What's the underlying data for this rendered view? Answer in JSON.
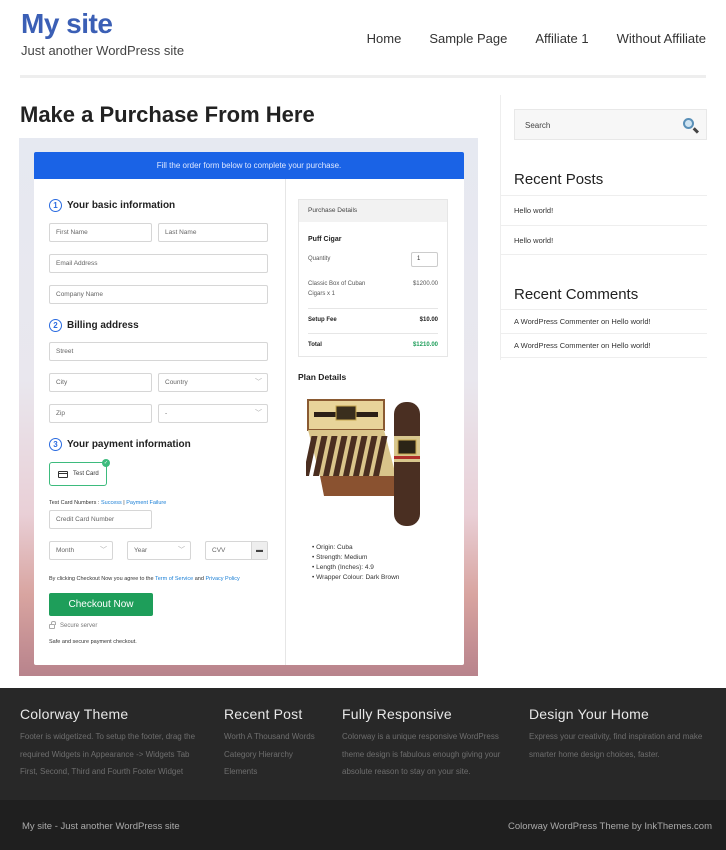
{
  "site": {
    "title": "My site",
    "tagline": "Just another WordPress site"
  },
  "nav": [
    "Home",
    "Sample Page",
    "Affiliate 1",
    "Without Affiliate"
  ],
  "page_title": "Make a Purchase From Here",
  "form": {
    "banner": "Fill the order form below to complete your purchase.",
    "section1": {
      "num": "1",
      "title": "Your basic information"
    },
    "section2": {
      "num": "2",
      "title": "Billing address"
    },
    "section3": {
      "num": "3",
      "title": "Your payment information"
    },
    "placeholders": {
      "first_name": "First Name",
      "last_name": "Last Name",
      "email": "Email Address",
      "company": "Company Name",
      "street": "Street",
      "city": "City",
      "country": "Country",
      "zip": "Zip",
      "state": "-",
      "card_number": "Credit Card Number",
      "month": "Month",
      "year": "Year",
      "cvv": "CVV"
    },
    "payment_method": "Test Card",
    "test_card_label": "Test Card Numbers :",
    "test_success": "Success",
    "test_sep": "|",
    "test_failure": "Payment Failure",
    "agree_prefix": "By clicking Checkout Now you agree to the",
    "terms": "Term of Service",
    "agree_and": "and",
    "privacy": "Privacy Policy",
    "checkout_label": "Checkout Now",
    "secure_label": "Secure server",
    "safe_label": "Safe and secure payment checkout."
  },
  "purchase": {
    "header": "Purchase Details",
    "product": "Puff Cigar",
    "quantity_label": "Quantity",
    "quantity": "1",
    "item_line1": "Classic Box of Cuban",
    "item_line2": "Cigars x 1",
    "item_price": "$1200.00",
    "setup_label": "Setup Fee",
    "setup_price": "$10.00",
    "total_label": "Total",
    "total_price": "$1210.00",
    "total_color": "#1e9e5a"
  },
  "plan": {
    "title": "Plan Details",
    "bullets": [
      "Origin: Cuba",
      "Strength: Medium",
      "Length (Inches): 4.9",
      "Wrapper Colour: Dark Brown"
    ]
  },
  "sidebar": {
    "search_placeholder": "Search",
    "recent_posts_title": "Recent Posts",
    "recent_posts": [
      "Hello world!",
      "Hello world!"
    ],
    "recent_comments_title": "Recent Comments",
    "recent_comments": [
      "A WordPress Commenter on Hello world!",
      "A WordPress Commenter on Hello world!"
    ]
  },
  "footer": {
    "cols": [
      {
        "title": "Colorway Theme",
        "lines": [
          "Footer is widgetized. To setup the footer, drag the",
          "required Widgets in Appearance -> Widgets Tab",
          "First, Second, Third and Fourth Footer Widget"
        ]
      },
      {
        "title": "Recent Post",
        "lines": [
          "Worth A Thousand Words",
          "Category Hierarchy",
          "Elements"
        ]
      },
      {
        "title": "Fully Responsive",
        "lines": [
          "Colorway is a unique responsive WordPress",
          "theme design is fabulous enough giving your",
          "absolute reason to stay on your site."
        ]
      },
      {
        "title": "Design Your Home",
        "lines": [
          "Express your creativity, find inspiration and make",
          "smarter home design choices, faster."
        ]
      }
    ],
    "bottom_left": "My site - Just another WordPress site",
    "bottom_right": "Colorway WordPress Theme by InkThemes.com"
  },
  "colors": {
    "brand": "#3b5fb5",
    "banner": "#1a63e6",
    "checkout": "#1e9e5a",
    "footer": "#282828"
  }
}
